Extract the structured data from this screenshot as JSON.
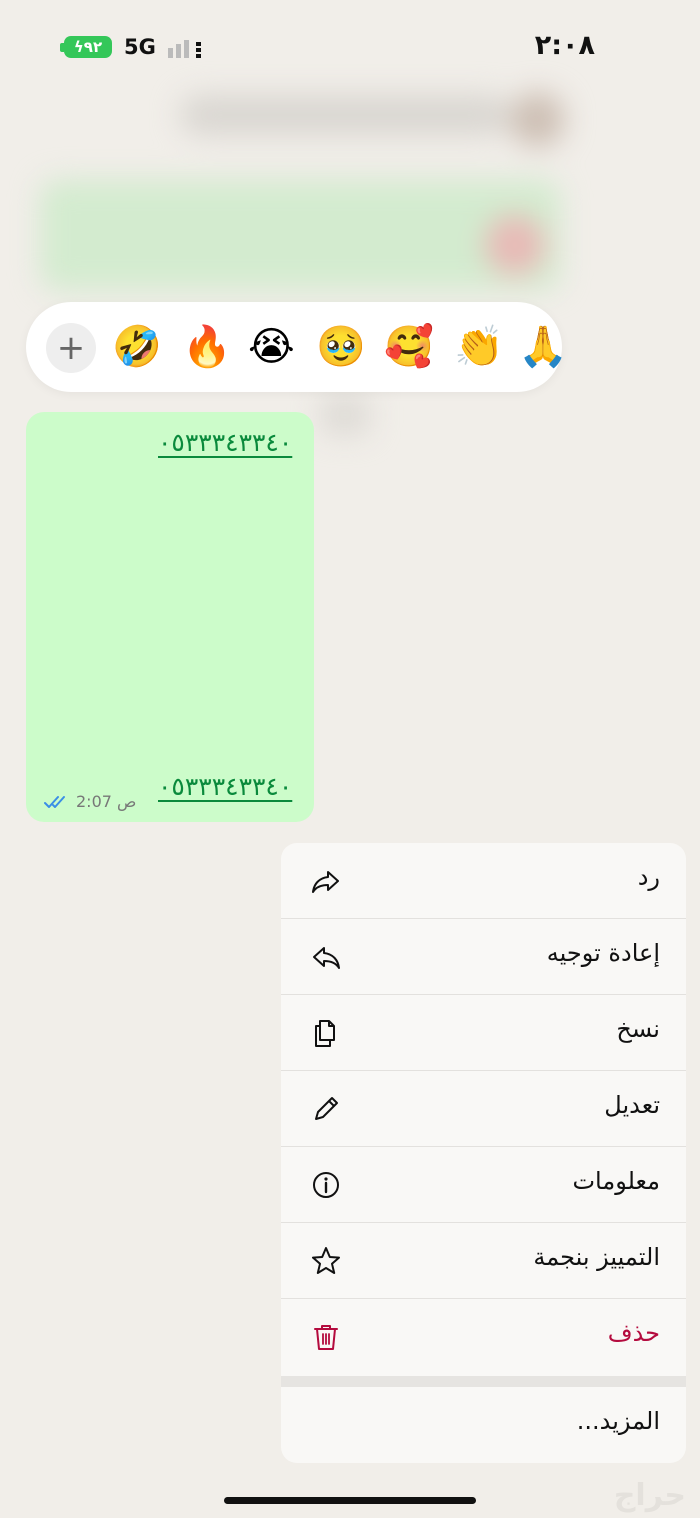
{
  "status_bar": {
    "time": "٢:٠٨",
    "battery": "٩٢",
    "network": "5G"
  },
  "reactions": {
    "emojis": [
      "🙏",
      "👏",
      "🥰",
      "🥹",
      "😭",
      "🔥",
      "🤣"
    ],
    "add_label": "+"
  },
  "message": {
    "phone_top": "٠٥٣٣٣٤٣٣٤٠",
    "phone_bottom": "٠٥٣٣٣٤٣٣٤٠",
    "time": "2:07 ص",
    "status_icon": "double-check-icon"
  },
  "menu": {
    "items": [
      {
        "label": "رد",
        "icon": "reply-icon"
      },
      {
        "label": "إعادة توجيه",
        "icon": "forward-icon"
      },
      {
        "label": "نسخ",
        "icon": "copy-icon"
      },
      {
        "label": "تعديل",
        "icon": "pencil-icon"
      },
      {
        "label": "معلومات",
        "icon": "info-icon"
      },
      {
        "label": "التمييز بنجمة",
        "icon": "star-icon"
      },
      {
        "label": "حذف",
        "icon": "trash-icon"
      }
    ],
    "more_label": "المزيد..."
  },
  "colors": {
    "bubble": "#ccfcca",
    "link": "#0a8a3c",
    "danger": "#b40b3e",
    "battery": "#34c759"
  }
}
